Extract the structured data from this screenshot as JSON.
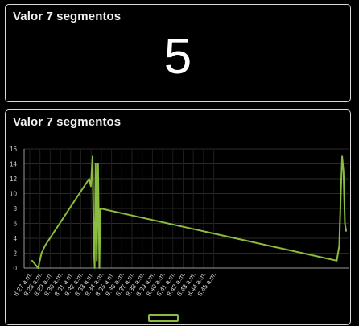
{
  "widgets": [
    {
      "title": "Valor 7 segmentos",
      "value": "5"
    },
    {
      "title": "Valor 7 segmentos"
    }
  ],
  "chart_data": {
    "type": "line",
    "xlabel": "",
    "ylabel": "",
    "ylim": [
      0,
      16
    ],
    "yticks": [
      0,
      2,
      4,
      6,
      8,
      10,
      12,
      14,
      16
    ],
    "xticks": [
      "8:27 a.m.",
      "8:28 a.m.",
      "8:29 a.m.",
      "8:30 a.m.",
      "8:31 a.m.",
      "8:32 a.m.",
      "8:33 a.m.",
      "8:34 a.m.",
      "8:35 a.m.",
      "8:36 a.m.",
      "8:37 a.m.",
      "8:38 a.m.",
      "8:39 a.m.",
      "8:40 a.m.",
      "8:41 a.m.",
      "8:42 a.m.",
      "8:43 a.m.",
      "8:44 a.m.",
      "8:45 a.m."
    ],
    "grid": true,
    "legend": "bottom",
    "series": [
      {
        "name": "",
        "color": "#8cbc3f",
        "points": [
          [
            0.0,
            1
          ],
          [
            0.35,
            0
          ],
          [
            0.55,
            2
          ],
          [
            0.75,
            3
          ],
          [
            3.35,
            12
          ],
          [
            3.45,
            11
          ],
          [
            3.55,
            15
          ],
          [
            3.62,
            3
          ],
          [
            3.67,
            0
          ],
          [
            3.73,
            14
          ],
          [
            3.8,
            1
          ],
          [
            3.87,
            14
          ],
          [
            3.95,
            0
          ],
          [
            4.0,
            8
          ],
          [
            17.9,
            1
          ],
          [
            18.05,
            3
          ],
          [
            18.15,
            11
          ],
          [
            18.22,
            15
          ],
          [
            18.3,
            13
          ],
          [
            18.38,
            6
          ],
          [
            18.45,
            5
          ]
        ]
      }
    ]
  }
}
